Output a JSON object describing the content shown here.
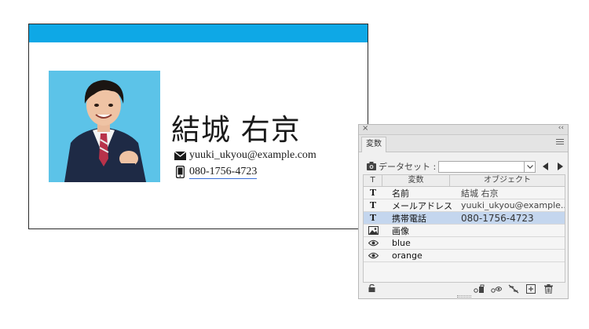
{
  "card": {
    "name": "結城 右京",
    "email": "yuuki_ukyou@example.com",
    "phone": "080-1756-4723",
    "band_color": "#0ea8e6",
    "photo_bg": "#5cc3e8"
  },
  "panel": {
    "close": "×",
    "collapse": "‹‹",
    "tab": "変数",
    "dataset_label": "データセット :",
    "dataset_value": "",
    "columns": {
      "type": "T",
      "variable": "変数",
      "object": "オブジェクト"
    },
    "rows": [
      {
        "type": "text",
        "icon": "text-type-icon",
        "glyph": "T",
        "variable": "名前",
        "object": "結城 右京",
        "selected": false
      },
      {
        "type": "text",
        "icon": "text-type-icon",
        "glyph": "T",
        "variable": "メールアドレス",
        "object": "yuuki_ukyou@example...",
        "selected": false
      },
      {
        "type": "text",
        "icon": "text-type-icon",
        "glyph": "T",
        "variable": "携帯電話",
        "object": "080-1756-4723",
        "selected": true
      },
      {
        "type": "image",
        "icon": "image-type-icon",
        "glyph": "",
        "variable": "画像",
        "object": "",
        "selected": false
      },
      {
        "type": "visibility",
        "icon": "visibility-type-icon",
        "glyph": "",
        "variable": "blue",
        "object": "",
        "selected": false
      },
      {
        "type": "visibility",
        "icon": "visibility-type-icon",
        "glyph": "",
        "variable": "orange",
        "object": "",
        "selected": false
      }
    ],
    "selection_color": "#c4d6ee"
  }
}
